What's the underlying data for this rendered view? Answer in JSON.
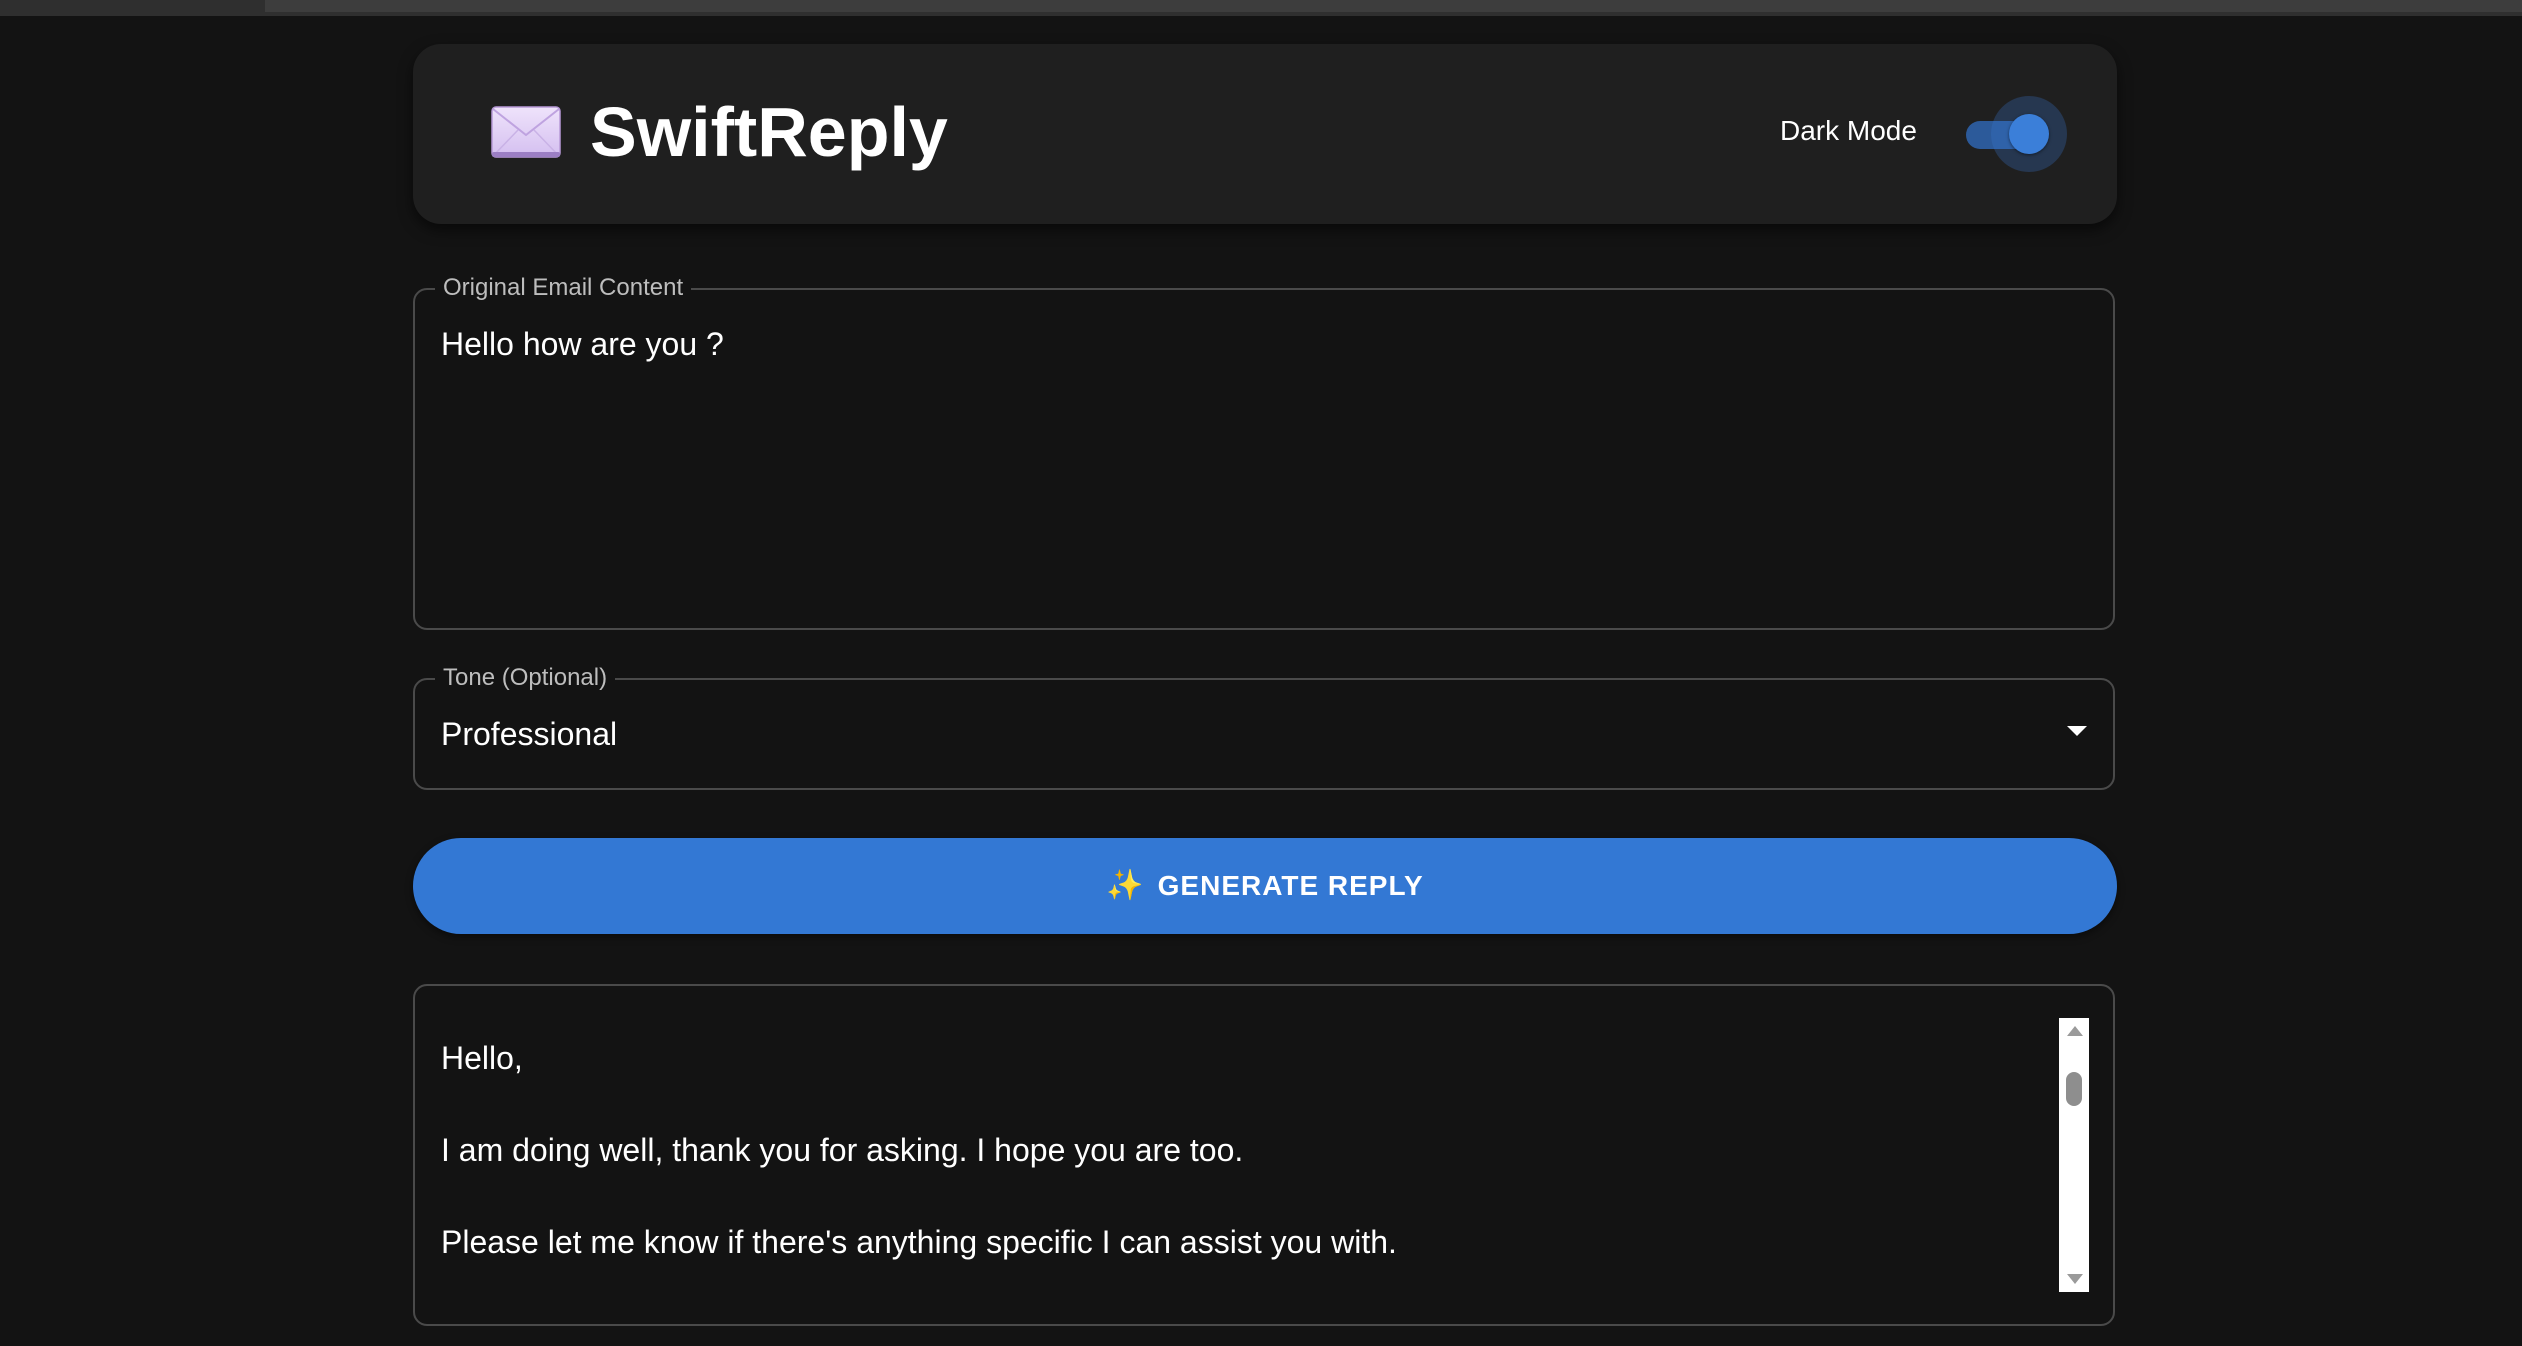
{
  "header": {
    "app_icon": "envelope-icon",
    "title": "SwiftReply",
    "dark_mode_label": "Dark Mode",
    "dark_mode_on": true
  },
  "email_input": {
    "label": "Original Email Content",
    "value": "Hello how are you ?"
  },
  "tone_select": {
    "label": "Tone (Optional)",
    "selected": "Professional"
  },
  "generate_button": {
    "icon": "sparkles-icon",
    "label": "GENERATE REPLY"
  },
  "reply_output": {
    "lines": [
      "Hello,",
      "I am doing well, thank you for asking. I hope you are too.",
      "Please let me know if there's anything specific I can assist you with."
    ]
  },
  "colors": {
    "background": "#131313",
    "card": "#1f1f1f",
    "accent": "#3378d4",
    "border": "#4a4a4a"
  }
}
